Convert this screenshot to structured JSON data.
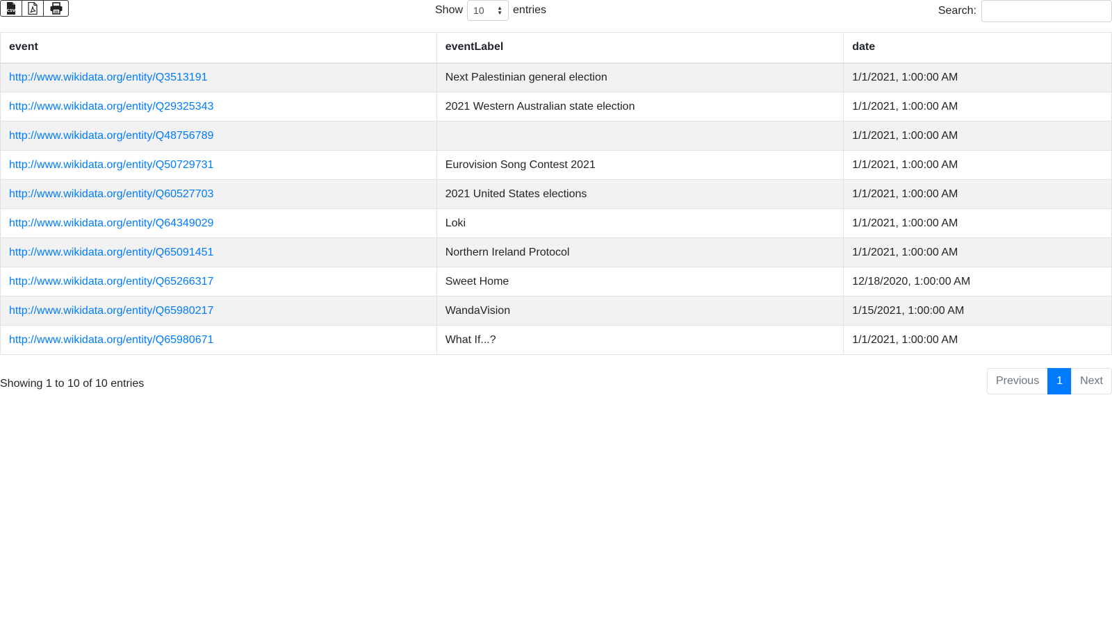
{
  "toolbar": {
    "export_buttons": [
      {
        "icon": "csv-file-icon",
        "label": "CSV"
      },
      {
        "icon": "pdf-file-icon"
      },
      {
        "icon": "print-icon"
      }
    ]
  },
  "length": {
    "label_before": "Show",
    "selected": "10",
    "label_after": "entries"
  },
  "search": {
    "label": "Search:",
    "value": "",
    "placeholder": ""
  },
  "table": {
    "headers": [
      "event",
      "eventLabel",
      "date"
    ],
    "rows": [
      {
        "event": "http://www.wikidata.org/entity/Q3513191",
        "eventLabel": "Next Palestinian general election",
        "date": "1/1/2021, 1:00:00 AM"
      },
      {
        "event": "http://www.wikidata.org/entity/Q29325343",
        "eventLabel": "2021 Western Australian state election",
        "date": "1/1/2021, 1:00:00 AM"
      },
      {
        "event": "http://www.wikidata.org/entity/Q48756789",
        "eventLabel": "",
        "date": "1/1/2021, 1:00:00 AM"
      },
      {
        "event": "http://www.wikidata.org/entity/Q50729731",
        "eventLabel": "Eurovision Song Contest 2021",
        "date": "1/1/2021, 1:00:00 AM"
      },
      {
        "event": "http://www.wikidata.org/entity/Q60527703",
        "eventLabel": "2021 United States elections",
        "date": "1/1/2021, 1:00:00 AM"
      },
      {
        "event": "http://www.wikidata.org/entity/Q64349029",
        "eventLabel": "Loki",
        "date": "1/1/2021, 1:00:00 AM"
      },
      {
        "event": "http://www.wikidata.org/entity/Q65091451",
        "eventLabel": "Northern Ireland Protocol",
        "date": "1/1/2021, 1:00:00 AM"
      },
      {
        "event": "http://www.wikidata.org/entity/Q65266317",
        "eventLabel": "Sweet Home",
        "date": "12/18/2020, 1:00:00 AM"
      },
      {
        "event": "http://www.wikidata.org/entity/Q65980217",
        "eventLabel": "WandaVision",
        "date": "1/15/2021, 1:00:00 AM"
      },
      {
        "event": "http://www.wikidata.org/entity/Q65980671",
        "eventLabel": "What If...?",
        "date": "1/1/2021, 1:00:00 AM"
      }
    ]
  },
  "footer": {
    "info": "Showing 1 to 10 of 10 entries",
    "pagination": {
      "previous": "Previous",
      "current": "1",
      "next": "Next"
    }
  },
  "colors": {
    "link": "#007bff",
    "active_page": "#007bff",
    "stripe": "#f2f2f2",
    "border": "#dee2e6"
  }
}
